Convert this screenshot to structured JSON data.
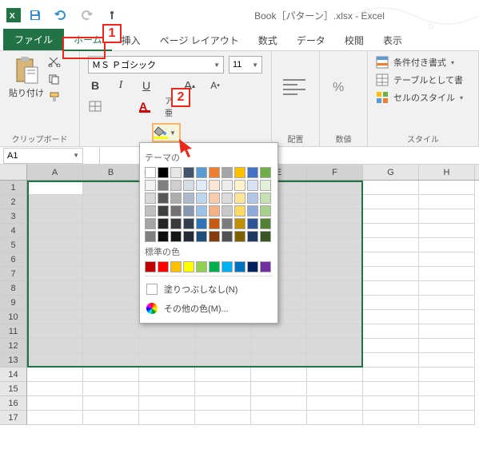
{
  "titlebar": {
    "title": "Book［パターン］.xlsx - Excel"
  },
  "tabs": {
    "file": "ファイル",
    "home": "ホーム",
    "insert": "挿入",
    "pagelayout": "ページ レイアウト",
    "formulas": "数式",
    "data": "データ",
    "review": "校閲",
    "view": "表示"
  },
  "ribbon": {
    "clipboard": {
      "paste": "貼り付け",
      "label": "クリップボード"
    },
    "font": {
      "name": "ＭＳ Ｐゴシック",
      "size": "11",
      "bold": "B",
      "italic": "I",
      "underline": "U",
      "grow": "A",
      "shrink": "A",
      "ruby": "ア亜"
    },
    "alignment": {
      "label": "配置"
    },
    "number": {
      "label": "数値"
    },
    "styles": {
      "conditional": "条件付き書式",
      "table": "テーブルとして書",
      "cellstyles": "セルのスタイル",
      "label": "スタイル"
    }
  },
  "popup": {
    "theme_label": "テーマの",
    "standard_label": "標準の色",
    "nofill": "塗りつぶしなし(N)",
    "morecolors": "その他の色(M)...",
    "theme_row1": [
      "#ffffff",
      "#000000",
      "#e7e6e6",
      "#44546a",
      "#5b9bd5",
      "#ed7d31",
      "#a5a5a5",
      "#ffc000",
      "#4472c4",
      "#70ad47"
    ],
    "theme_tints": [
      [
        "#f2f2f2",
        "#7f7f7f",
        "#d0cece",
        "#d6dce4",
        "#deebf6",
        "#fbe5d5",
        "#ededed",
        "#fff2cc",
        "#d9e2f3",
        "#e2efd9"
      ],
      [
        "#d8d8d8",
        "#595959",
        "#aeabab",
        "#adb9ca",
        "#bdd7ee",
        "#f7cbac",
        "#dbdbdb",
        "#fee599",
        "#b4c6e7",
        "#c5e0b3"
      ],
      [
        "#bfbfbf",
        "#3f3f3f",
        "#757070",
        "#8496b0",
        "#9cc3e5",
        "#f4b183",
        "#c9c9c9",
        "#ffd965",
        "#8eaadb",
        "#a8d08d"
      ],
      [
        "#a5a5a5",
        "#262626",
        "#3a3838",
        "#323f4f",
        "#2e75b5",
        "#c55a11",
        "#7b7b7b",
        "#bf9000",
        "#2f5496",
        "#538135"
      ],
      [
        "#7f7f7f",
        "#0c0c0c",
        "#171616",
        "#222a35",
        "#1e4e79",
        "#833c0b",
        "#525252",
        "#7f6000",
        "#1f3864",
        "#375623"
      ]
    ],
    "standard": [
      "#c00000",
      "#ff0000",
      "#ffc000",
      "#ffff00",
      "#92d050",
      "#00b050",
      "#00b0f0",
      "#0070c0",
      "#002060",
      "#7030a0"
    ]
  },
  "namebox": {
    "ref": "A1"
  },
  "columns": [
    "A",
    "B",
    "C",
    "D",
    "E",
    "F",
    "G",
    "H"
  ],
  "rows_count": 17,
  "callouts": {
    "c1": "1",
    "c2": "2"
  }
}
